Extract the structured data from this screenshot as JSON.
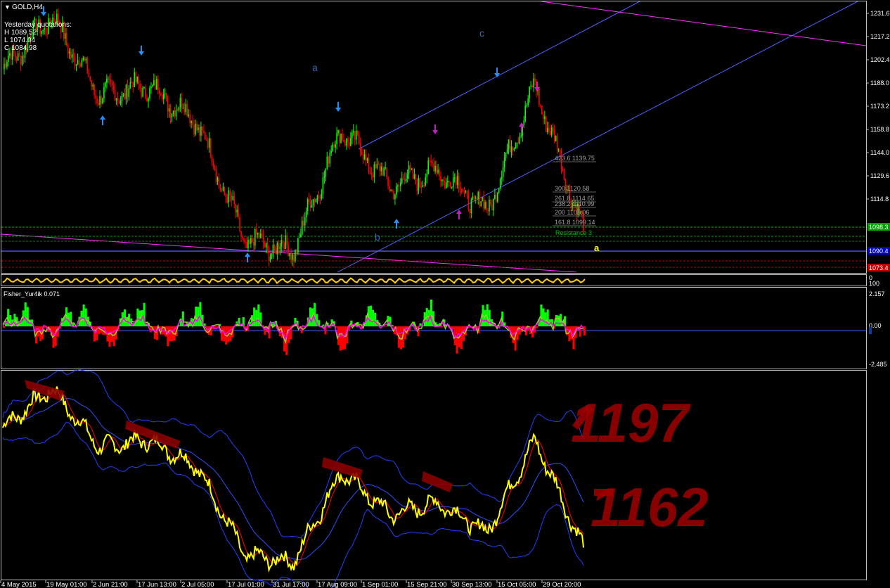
{
  "window": {
    "title": "GOLD,H4"
  },
  "quotations": {
    "heading": "Yesterday quotations:",
    "high": "H 1089.52",
    "low": "L 1074.04",
    "close": "C 1084.98"
  },
  "price_axis": [
    "1231.6",
    "1217.2",
    "1202.4",
    "1188.0",
    "1173.2",
    "1158.8",
    "1144.0",
    "1129.6",
    "1114.8"
  ],
  "price_tags": [
    {
      "text": "1098.3",
      "color": "#00a000"
    },
    {
      "text": "1090.4",
      "color": "#0000c0"
    },
    {
      "text": "1073.4",
      "color": "#c00000"
    }
  ],
  "wave_labels": {
    "a_top": "a",
    "b": "b",
    "c": "c",
    "a_right": "a"
  },
  "fib_levels": [
    {
      "level": "423.6",
      "price": "1139.75"
    },
    {
      "level": "300",
      "price": "1120.58"
    },
    {
      "level": "261.8",
      "price": "1114.65"
    },
    {
      "level": "238.2",
      "price": "1110.99"
    },
    {
      "level": "200",
      "price": "1105.06"
    },
    {
      "level": "161.8",
      "price": "1099.14"
    }
  ],
  "resistance_label": "Resistance 3",
  "strip_axis": {
    "top": "0",
    "bottom": "100"
  },
  "fisher": {
    "label": "Fisher_Yur4ik 0.071",
    "axis": [
      "2.157",
      "0.00",
      "-2.485"
    ]
  },
  "annotations": {
    "upper": "1197",
    "lower": "1162"
  },
  "time_axis": [
    "4 May 2015",
    "19 May 01:00",
    "2 Jun 21:00",
    "17 Jun 13:00",
    "2 Jul 05:00",
    "17 Jul 01:00",
    "31 Jul 17:00",
    "17 Aug 09:00",
    "1 Sep 01:00",
    "15 Sep 21:00",
    "30 Sep 13:00",
    "15 Oct 05:00",
    "29 Oct 20:00"
  ],
  "colors": {
    "bull": "#00ff00",
    "bear": "#ff0000",
    "trendline": "#5050ff",
    "magenta": "#ff00ff",
    "yellow": "#ffff00",
    "arrow_blue": "#2090ff",
    "arrow_magenta": "#c020c0"
  },
  "chart_data": {
    "type": "line",
    "x": [
      "4 May 2015",
      "19 May 01:00",
      "2 Jun 21:00",
      "17 Jun 13:00",
      "2 Jul 05:00",
      "17 Jul 01:00",
      "31 Jul 17:00",
      "17 Aug 09:00",
      "1 Sep 01:00",
      "15 Sep 21:00",
      "30 Sep 13:00",
      "15 Oct 05:00",
      "29 Oct 20:00"
    ],
    "series": [
      {
        "values": [
          1196,
          1228,
          1180,
          1186,
          1165,
          1092,
          1086,
          1160,
          1125,
          1135,
          1110,
          1186,
          1098
        ]
      }
    ],
    "ylim": [
      1073,
      1237
    ]
  }
}
